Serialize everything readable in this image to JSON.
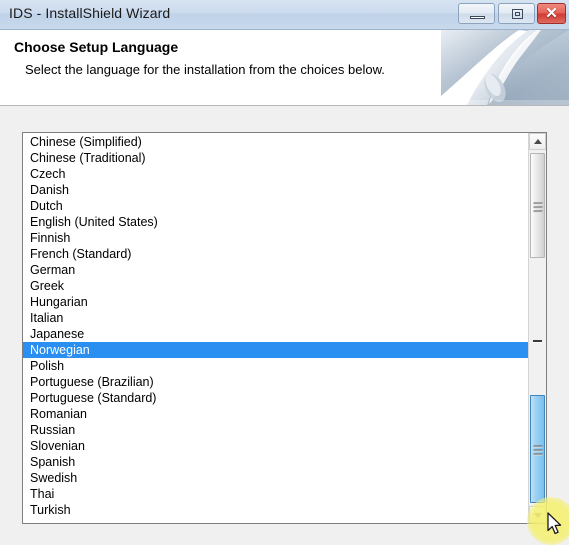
{
  "window": {
    "title": "IDS - InstallShield Wizard",
    "caption_buttons": [
      {
        "name": "minimize",
        "label": "Minimize",
        "icon": "minimize-icon"
      },
      {
        "name": "maximize",
        "label": "Maximize",
        "icon": "maximize-icon"
      },
      {
        "name": "close",
        "label": "Close",
        "icon": "close-icon",
        "glyph": "✕",
        "color": "#cf3b33"
      }
    ]
  },
  "header": {
    "title": "Choose Setup Language",
    "subtitle": "Select the language for the installation from the choices below."
  },
  "language_list": {
    "selected": "Norwegian",
    "selected_index": 13,
    "highlight_color": "#2a8ff0",
    "items": [
      "Chinese (Simplified)",
      "Chinese (Traditional)",
      "Czech",
      "Danish",
      "Dutch",
      "English (United States)",
      "Finnish",
      "French (Standard)",
      "German",
      "Greek",
      "Hungarian",
      "Italian",
      "Japanese",
      "Norwegian",
      "Polish",
      "Portuguese (Brazilian)",
      "Portuguese (Standard)",
      "Romanian",
      "Russian",
      "Slovenian",
      "Spanish",
      "Swedish",
      "Thai",
      "Turkish"
    ]
  },
  "scrollbar": {
    "up_arrow": "scroll-up-arrow",
    "down_arrow": "scroll-down-arrow",
    "thumb_gray": "scrollbar-thumb",
    "thumb_blue": "scrollbar-thumb-active",
    "thumb_blue_color": "#79c0ee"
  },
  "cursor": {
    "icon": "mouse-pointer",
    "click_highlight_color": "#f4f06e"
  }
}
